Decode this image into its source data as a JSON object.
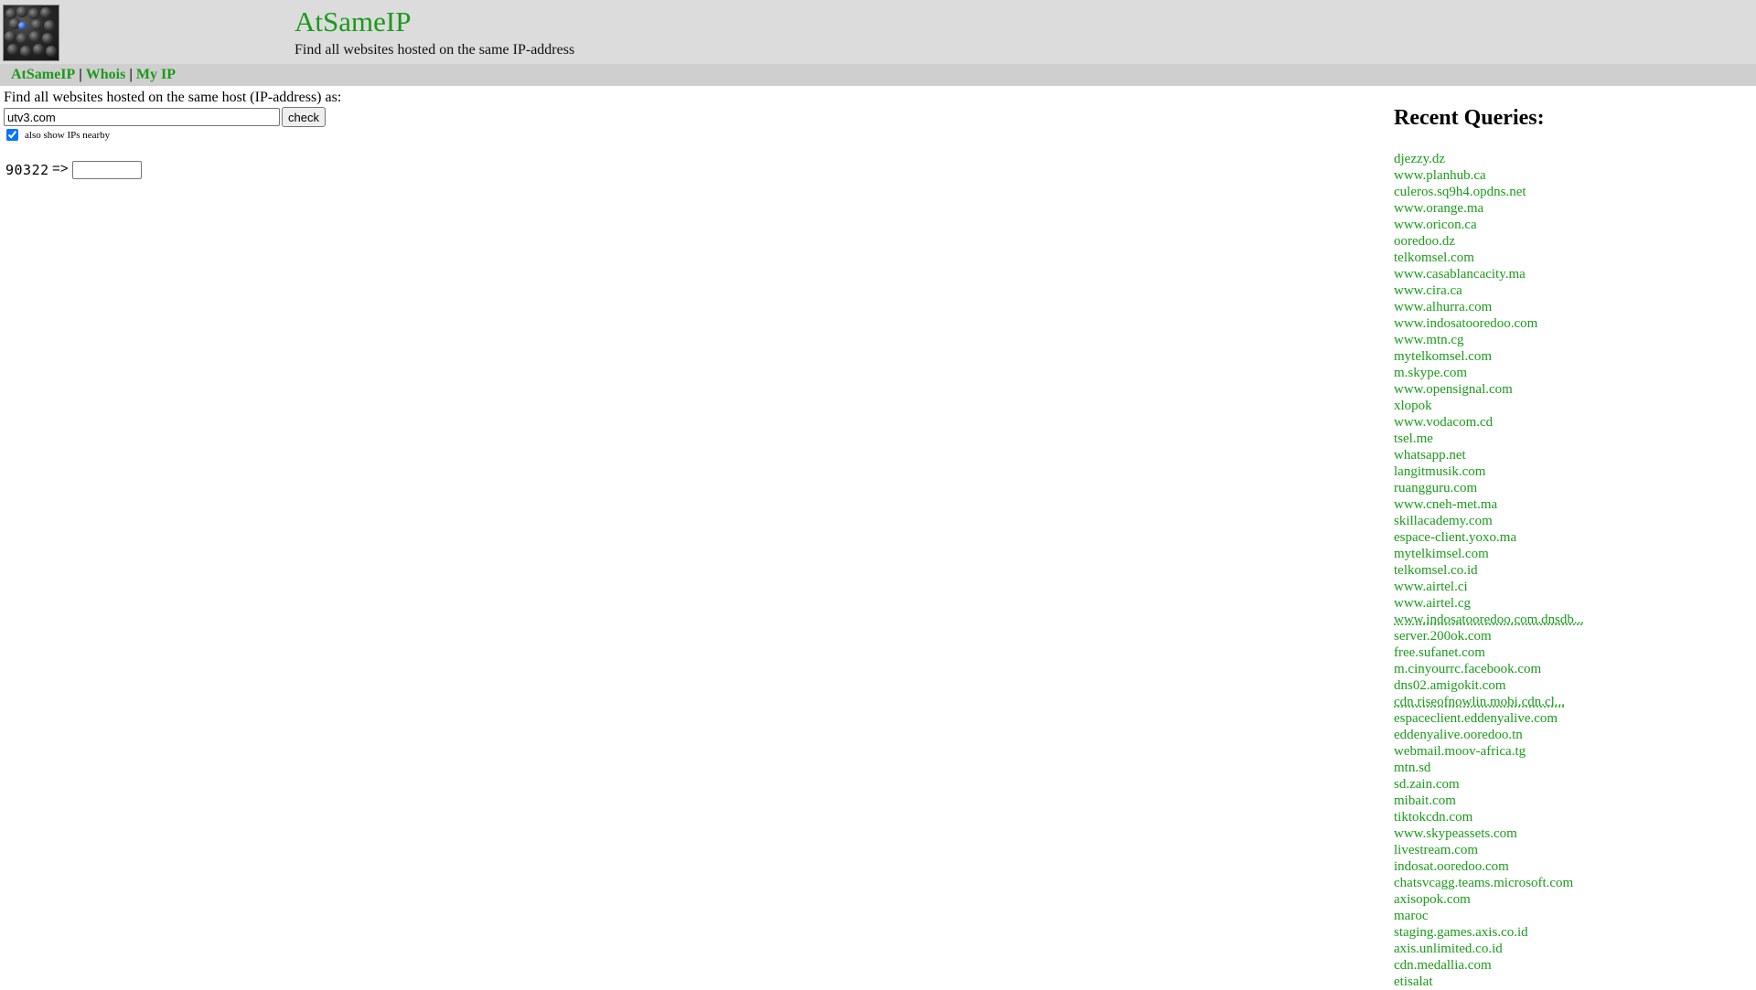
{
  "header": {
    "title": "AtSameIP",
    "subtitle": "Find all websites hosted on the same IP-address"
  },
  "nav": {
    "items": [
      "AtSameIP",
      "Whois",
      "My IP"
    ]
  },
  "search": {
    "label": "Find all websites hosted on the same host (IP-address) as:",
    "value": "utv3.com",
    "button": "check",
    "nearby_label": "also show IPs nearby",
    "nearby_checked": true
  },
  "captcha": {
    "code": "90322",
    "arrow": "=>",
    "value": ""
  },
  "recent": {
    "title": "Recent Queries:",
    "items": [
      "djezzy.dz",
      "www.planhub.ca",
      "culeros.sq9h4.opdns.net",
      "www.orange.ma",
      "www.oricon.ca",
      "ooredoo.dz",
      "telkomsel.com",
      "www.casablancacity.ma",
      "www.cira.ca",
      "www.alhurra.com",
      "www.indosatooredoo.com",
      "www.mtn.cg",
      "mytelkomsel.com",
      "m.skype.com",
      "www.opensignal.com",
      "xlopok",
      "www.vodacom.cd",
      "tsel.me",
      "whatsapp.net",
      "langitmusik.com",
      "ruangguru.com",
      "www.cneh-met.ma",
      "skillacademy.com",
      "espace-client.yoxo.ma",
      "mytelkimsel.com",
      "telkomsel.co.id",
      "www.airtel.ci",
      "www.airtel.cg",
      "www.indosatooredoo.com.dnsdb...",
      "server.200ok.com",
      "free.sufanet.com",
      "m.cinyourrc.facebook.com",
      "dns02.amigokit.com",
      "cdn.riseofnowlin.mobi.cdn.cl...",
      "espaceclient.eddenyalive.com",
      "eddenyalive.ooredoo.tn",
      "webmail.moov-africa.tg",
      "mtn.sd",
      "sd.zain.com",
      "mibait.com",
      "tiktokcdn.com",
      "www.skypeassets.com",
      "livestream.com",
      "indosat.ooredoo.com",
      "chatsvcagg.teams.microsoft.com",
      "axisopok.com",
      "maroc",
      "staging.games.axis.co.id",
      "axis.unlimited.co.id",
      "cdn.medallia.com",
      "etisalat"
    ],
    "truncated_indices": [
      28,
      33
    ]
  }
}
